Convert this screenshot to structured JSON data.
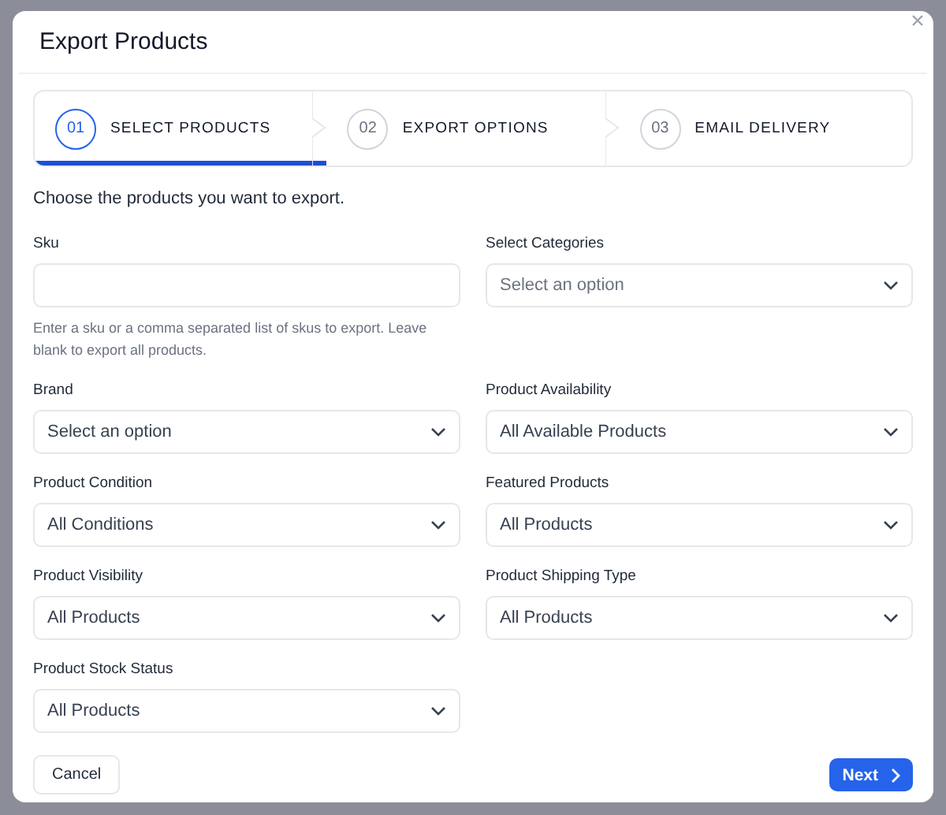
{
  "modal": {
    "title": "Export Products",
    "steps": [
      {
        "number": "01",
        "label": "SELECT PRODUCTS",
        "selected": true
      },
      {
        "number": "02",
        "label": "EXPORT OPTIONS",
        "selected": false
      },
      {
        "number": "03",
        "label": "EMAIL DELIVERY",
        "selected": false
      }
    ],
    "intro": "Choose the products you want to export.",
    "fields": [
      {
        "kind": "text",
        "label": "Sku",
        "help": "Enter a sku or a comma separated list of skus to export. Leave blank to export all products."
      },
      {
        "kind": "select",
        "label": "Select Categories",
        "placeholder": "Select an option"
      },
      {
        "kind": "select",
        "label": "Brand",
        "value": "Select an option"
      },
      {
        "kind": "select",
        "label": "Product Availability",
        "value": "All Available Products"
      },
      {
        "kind": "select",
        "label": "Product Condition",
        "value": "All Conditions"
      },
      {
        "kind": "select",
        "label": "Featured Products",
        "value": "All Products"
      },
      {
        "kind": "select",
        "label": "Product Visibility",
        "value": "All Products"
      },
      {
        "kind": "select",
        "label": "Product Shipping Type",
        "value": "All Products"
      },
      {
        "kind": "select",
        "label": "Product Stock Status",
        "value": "All Products"
      }
    ],
    "buttons": {
      "cancel": "Cancel",
      "next": "Next"
    }
  }
}
